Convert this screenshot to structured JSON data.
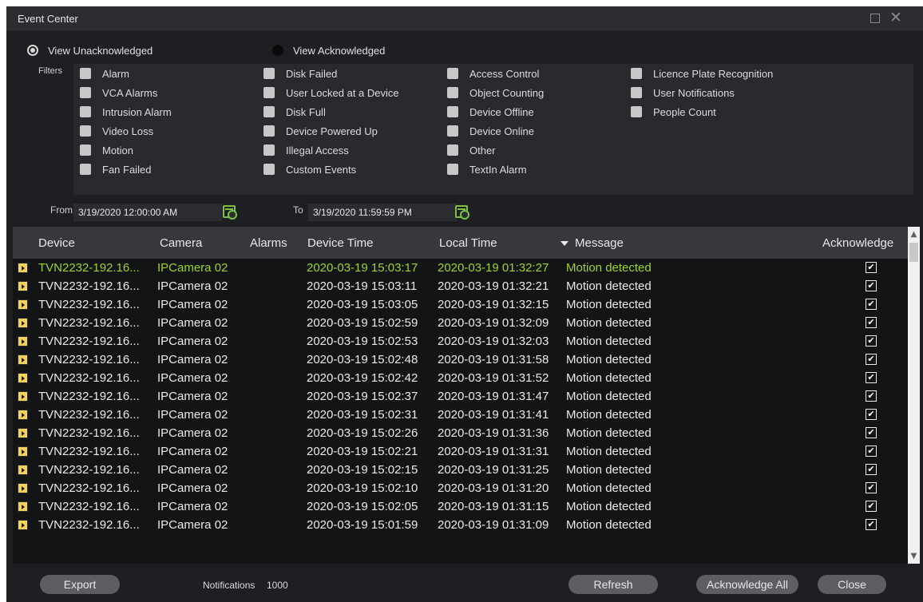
{
  "window": {
    "title": "Event Center"
  },
  "view_options": {
    "unacknowledged": "View Unacknowledged",
    "acknowledged": "View Acknowledged"
  },
  "filters_label": "Filters",
  "filter_columns": [
    [
      "Alarm",
      "VCA Alarms",
      "Intrusion Alarm",
      "Video Loss",
      "Motion",
      "Fan Failed"
    ],
    [
      "Disk Failed",
      "User Locked at a Device",
      "Disk Full",
      "Device Powered Up",
      "Illegal Access",
      "Custom Events"
    ],
    [
      "Access Control",
      "Object Counting",
      "Device Offline",
      "Device Online",
      "Other",
      "TextIn Alarm"
    ],
    [
      "Licence Plate Recognition",
      "User Notifications",
      "People Count"
    ]
  ],
  "date_range": {
    "from_label": "From",
    "from_value": "3/19/2020 12:00:00 AM",
    "to_label": "To",
    "to_value": "3/19/2020 11:59:59 PM"
  },
  "table": {
    "columns": [
      "Device",
      "Camera",
      "Alarms",
      "Device Time",
      "Local Time",
      "Message",
      "Acknowledge"
    ],
    "sort_column": "Local Time",
    "rows": [
      {
        "device": "TVN2232-192.16...",
        "camera": "IPCamera 02",
        "alarms": "",
        "device_time": "2020-03-19 15:03:17",
        "local_time": "2020-03-19 01:32:27",
        "message": "Motion detected",
        "ack": "✔"
      },
      {
        "device": "TVN2232-192.16...",
        "camera": "IPCamera 02",
        "alarms": "",
        "device_time": "2020-03-19 15:03:11",
        "local_time": "2020-03-19 01:32:21",
        "message": "Motion detected",
        "ack": "✔"
      },
      {
        "device": "TVN2232-192.16...",
        "camera": "IPCamera 02",
        "alarms": "",
        "device_time": "2020-03-19 15:03:05",
        "local_time": "2020-03-19 01:32:15",
        "message": "Motion detected",
        "ack": "✔"
      },
      {
        "device": "TVN2232-192.16...",
        "camera": "IPCamera 02",
        "alarms": "",
        "device_time": "2020-03-19 15:02:59",
        "local_time": "2020-03-19 01:32:09",
        "message": "Motion detected",
        "ack": "✔"
      },
      {
        "device": "TVN2232-192.16...",
        "camera": "IPCamera 02",
        "alarms": "",
        "device_time": "2020-03-19 15:02:53",
        "local_time": "2020-03-19 01:32:03",
        "message": "Motion detected",
        "ack": "✔"
      },
      {
        "device": "TVN2232-192.16...",
        "camera": "IPCamera 02",
        "alarms": "",
        "device_time": "2020-03-19 15:02:48",
        "local_time": "2020-03-19 01:31:58",
        "message": "Motion detected",
        "ack": "✔"
      },
      {
        "device": "TVN2232-192.16...",
        "camera": "IPCamera 02",
        "alarms": "",
        "device_time": "2020-03-19 15:02:42",
        "local_time": "2020-03-19 01:31:52",
        "message": "Motion detected",
        "ack": "✔"
      },
      {
        "device": "TVN2232-192.16...",
        "camera": "IPCamera 02",
        "alarms": "",
        "device_time": "2020-03-19 15:02:37",
        "local_time": "2020-03-19 01:31:47",
        "message": "Motion detected",
        "ack": "✔"
      },
      {
        "device": "TVN2232-192.16...",
        "camera": "IPCamera 02",
        "alarms": "",
        "device_time": "2020-03-19 15:02:31",
        "local_time": "2020-03-19 01:31:41",
        "message": "Motion detected",
        "ack": "✔"
      },
      {
        "device": "TVN2232-192.16...",
        "camera": "IPCamera 02",
        "alarms": "",
        "device_time": "2020-03-19 15:02:26",
        "local_time": "2020-03-19 01:31:36",
        "message": "Motion detected",
        "ack": "✔"
      },
      {
        "device": "TVN2232-192.16...",
        "camera": "IPCamera 02",
        "alarms": "",
        "device_time": "2020-03-19 15:02:21",
        "local_time": "2020-03-19 01:31:31",
        "message": "Motion detected",
        "ack": "✔"
      },
      {
        "device": "TVN2232-192.16...",
        "camera": "IPCamera 02",
        "alarms": "",
        "device_time": "2020-03-19 15:02:15",
        "local_time": "2020-03-19 01:31:25",
        "message": "Motion detected",
        "ack": "✔"
      },
      {
        "device": "TVN2232-192.16...",
        "camera": "IPCamera 02",
        "alarms": "",
        "device_time": "2020-03-19 15:02:10",
        "local_time": "2020-03-19 01:31:20",
        "message": "Motion detected",
        "ack": "✔"
      },
      {
        "device": "TVN2232-192.16...",
        "camera": "IPCamera 02",
        "alarms": "",
        "device_time": "2020-03-19 15:02:05",
        "local_time": "2020-03-19 01:31:15",
        "message": "Motion detected",
        "ack": "✔"
      },
      {
        "device": "TVN2232-192.16...",
        "camera": "IPCamera 02",
        "alarms": "",
        "device_time": "2020-03-19 15:01:59",
        "local_time": "2020-03-19 01:31:09",
        "message": "Motion detected",
        "ack": "✔"
      }
    ]
  },
  "footer": {
    "export": "Export",
    "notifications_label": "Notifications",
    "notifications_count": "1000",
    "refresh": "Refresh",
    "acknowledge_all": "Acknowledge All",
    "close": "Close"
  },
  "colors": {
    "selected_row_text": "#9fd32c",
    "calendar_icon": "#7cc242",
    "row_icon": "#f5d25a"
  },
  "icons": {
    "row": "video-clip-icon",
    "calendar": "calendar-clock-icon",
    "sort": "sort-down-icon"
  }
}
